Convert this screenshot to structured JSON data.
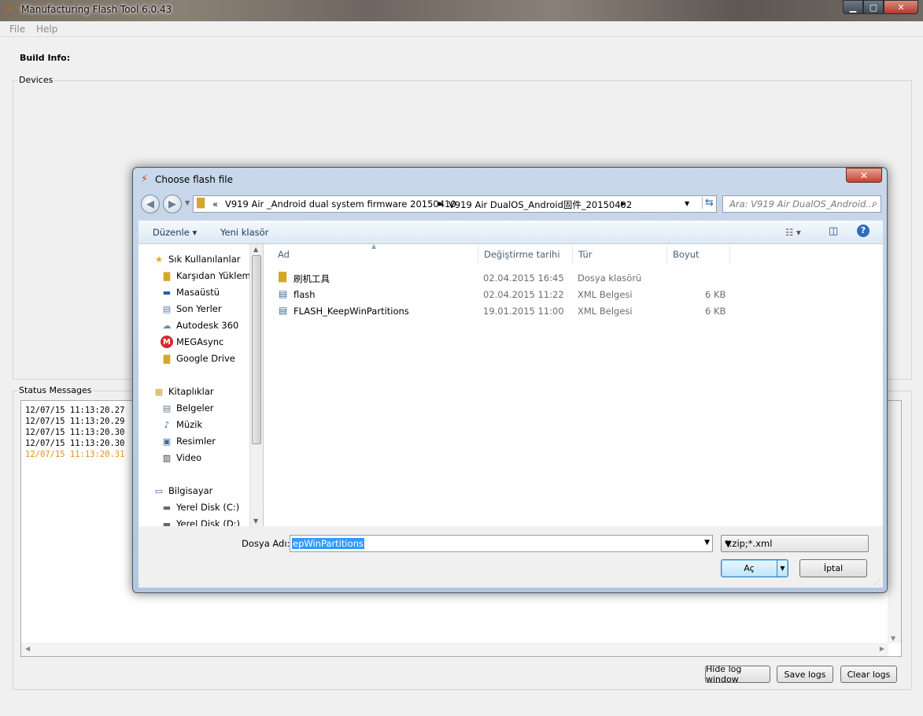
{
  "window": {
    "title": "Manufacturing Flash Tool 6.0.43"
  },
  "menu": {
    "file": "File",
    "help": "Help"
  },
  "main": {
    "build_info_label": "Build Info:",
    "devices_label": "Devices",
    "status_label": "Status Messages",
    "log_lines": [
      "12/07/15 11:13:20.27",
      "12/07/15 11:13:20.29",
      "12/07/15 11:13:20.30",
      "12/07/15 11:13:20.30",
      "12/07/15 11:13:20.31"
    ],
    "buttons": {
      "hide_log": "Hide log window",
      "save_logs": "Save logs",
      "clear_logs": "Clear logs"
    }
  },
  "dialog": {
    "title": "Choose flash file",
    "breadcrumb": {
      "overflow": "«",
      "segment1": "V919 Air _Android dual system firmware 20150410",
      "segment2": "V919 Air DualOS_Android固件_20150402"
    },
    "search_placeholder": "Ara: V919 Air DualOS_Android...",
    "toolbar": {
      "organize": "Düzenle ▾",
      "new_folder": "Yeni klasör"
    },
    "nav": {
      "favorites_header": "Sık Kullanılanlar",
      "favorites": [
        "Karşıdan Yüklem",
        "Masaüstü",
        "Son Yerler",
        "Autodesk 360",
        "MEGAsync",
        "Google Drive"
      ],
      "libraries_header": "Kitaplıklar",
      "libraries": [
        "Belgeler",
        "Müzik",
        "Resimler",
        "Video"
      ],
      "computer_header": "Bilgisayar",
      "computer": [
        "Yerel Disk (C:)",
        "Yerel Disk (D:)"
      ]
    },
    "columns": {
      "name": "Ad",
      "modified": "Değiştirme tarihi",
      "type": "Tür",
      "size": "Boyut"
    },
    "files": [
      {
        "name": "刷机工具",
        "modified": "02.04.2015 16:45",
        "type": "Dosya klasörü",
        "size": ""
      },
      {
        "name": "flash",
        "modified": "02.04.2015 11:22",
        "type": "XML Belgesi",
        "size": "6 KB"
      },
      {
        "name": "FLASH_KeepWinPartitions",
        "modified": "19.01.2015 11:00",
        "type": "XML Belgesi",
        "size": "6 KB"
      }
    ],
    "filename_label": "Dosya Adı:",
    "filename_value": "epWinPartitions",
    "filter_value": "*.zip;*.xml",
    "open_label": "Aç",
    "cancel_label": "İptal"
  },
  "colors": {
    "log_highlight": "#e8910c",
    "selection": "#3399ff"
  }
}
